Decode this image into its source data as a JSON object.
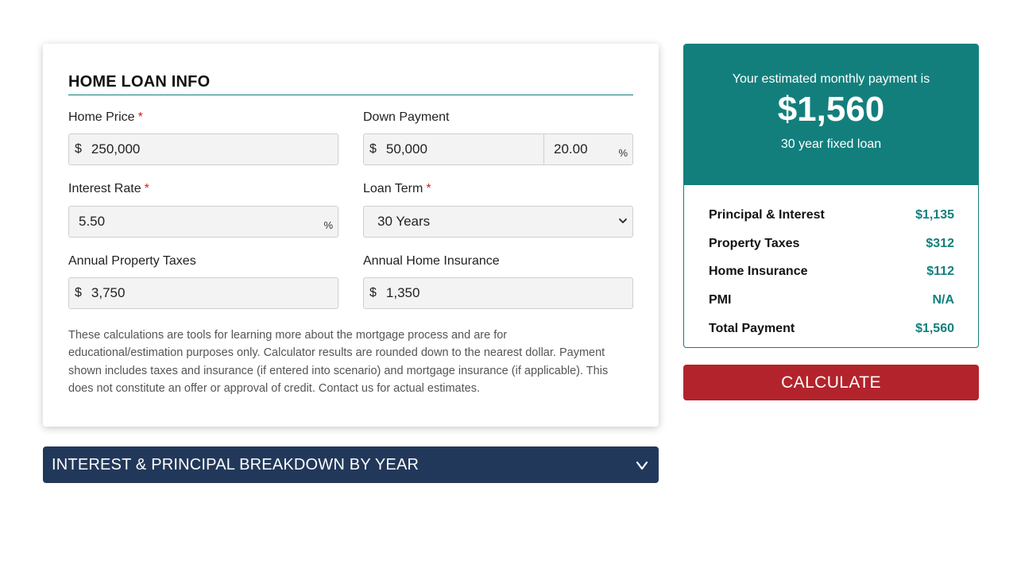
{
  "form": {
    "title": "HOME LOAN INFO",
    "home_price": {
      "label": "Home Price",
      "required": "*",
      "prefix": "$",
      "value": "250,000"
    },
    "down_payment": {
      "label": "Down Payment",
      "prefix": "$",
      "value": "50,000",
      "percent_value": "20.00",
      "percent_suffix": "%"
    },
    "interest_rate": {
      "label": "Interest Rate",
      "required": "*",
      "value": "5.50",
      "suffix": "%"
    },
    "loan_term": {
      "label": "Loan Term",
      "required": "*",
      "selected": "30 Years"
    },
    "property_taxes": {
      "label": "Annual Property Taxes",
      "prefix": "$",
      "value": "3,750"
    },
    "home_insurance": {
      "label": "Annual Home Insurance",
      "prefix": "$",
      "value": "1,350"
    },
    "disclaimer": "These calculations are tools for learning more about the mortgage process and are for educational/estimation purposes only. Calculator results are rounded down to the nearest dollar. Payment shown includes taxes and insurance (if entered into scenario) and mortgage insurance (if applicable). This does not constitute an offer or approval of credit. Contact us for actual estimates."
  },
  "breakdown": {
    "label": "INTEREST & PRINCIPAL BREAKDOWN BY YEAR",
    "icon": "chevron-down-icon"
  },
  "result": {
    "label": "Your estimated monthly payment is",
    "amount": "$1,560",
    "subtitle": "30 year fixed loan",
    "rows": [
      {
        "label": "Principal & Interest",
        "value": "$1,135"
      },
      {
        "label": "Property Taxes",
        "value": "$312"
      },
      {
        "label": "Home Insurance",
        "value": "$112"
      },
      {
        "label": "PMI",
        "value": "N/A"
      },
      {
        "label": "Total Payment",
        "value": "$1,560"
      }
    ]
  },
  "calculate_button": "CALCULATE",
  "colors": {
    "teal": "#137f7c",
    "navy": "#22385a",
    "red": "#b3232b",
    "required": "#d21f1f"
  }
}
